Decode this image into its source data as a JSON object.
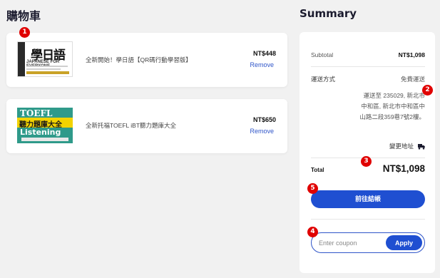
{
  "cart": {
    "title": "購物車",
    "items": [
      {
        "name": "全新開始！學日語【QR碼行動學習版】",
        "price": "NT$448",
        "remove_label": "Remove",
        "cover": {
          "big_text": "學日語",
          "sub_text": "JAPANESE FOR EVERYONE"
        }
      },
      {
        "name": "全新托福TOEFL iBT聽力題庫大全",
        "price": "NT$650",
        "remove_label": "Remove",
        "cover": {
          "top_text": "TOEFL",
          "band_text": "聽力題庫大全",
          "bottom_text": "Listening"
        }
      }
    ]
  },
  "summary": {
    "title": "Summary",
    "subtotal_label": "Subtotal",
    "subtotal_value": "NT$1,098",
    "shipping_label": "運送方式",
    "shipping_value": "免費運送",
    "address": "運送至 235029, 新北市 中和區, 新北市中和區中山路二段359巷7號2樓。",
    "change_address_label": "變更地址",
    "total_label": "Total",
    "total_value": "NT$1,098",
    "checkout_label": "前往結帳",
    "coupon_placeholder": "Enter coupon",
    "apply_label": "Apply"
  },
  "markers": [
    "1",
    "2",
    "3",
    "4",
    "5"
  ],
  "colors": {
    "accent": "#1f4fd1",
    "marker": "#e00000",
    "link": "#2f55c9",
    "background": "#f1f1f1"
  }
}
